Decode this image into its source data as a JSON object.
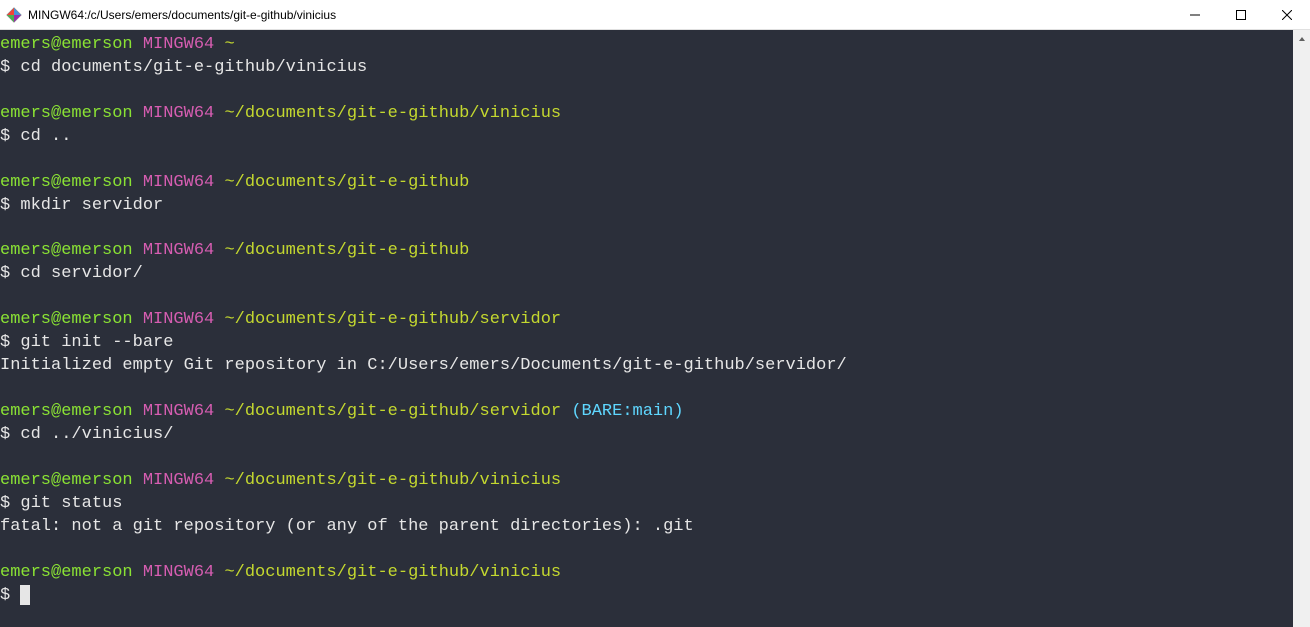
{
  "window": {
    "title": "MINGW64:/c/Users/emers/documents/git-e-github/vinicius"
  },
  "prompt": {
    "user": "emers@emerson",
    "shell": "MINGW64",
    "dollar": "$"
  },
  "blocks": [
    {
      "path": "~",
      "cmd": "cd documents/git-e-github/vinicius",
      "branch": "",
      "output": []
    },
    {
      "path": "~/documents/git-e-github/vinicius",
      "cmd": "cd ..",
      "branch": "",
      "output": []
    },
    {
      "path": "~/documents/git-e-github",
      "cmd": "mkdir servidor",
      "branch": "",
      "output": []
    },
    {
      "path": "~/documents/git-e-github",
      "cmd": "cd servidor/",
      "branch": "",
      "output": []
    },
    {
      "path": "~/documents/git-e-github/servidor",
      "cmd": "git init --bare",
      "branch": "",
      "output": [
        "Initialized empty Git repository in C:/Users/emers/Documents/git-e-github/servidor/"
      ]
    },
    {
      "path": "~/documents/git-e-github/servidor",
      "cmd": "cd ../vinicius/",
      "branch": "(BARE:main)",
      "output": []
    },
    {
      "path": "~/documents/git-e-github/vinicius",
      "cmd": "git status",
      "branch": "",
      "output": [
        "fatal: not a git repository (or any of the parent directories): .git"
      ]
    },
    {
      "path": "~/documents/git-e-github/vinicius",
      "cmd": "",
      "branch": "",
      "output": [],
      "cursor": true
    }
  ]
}
